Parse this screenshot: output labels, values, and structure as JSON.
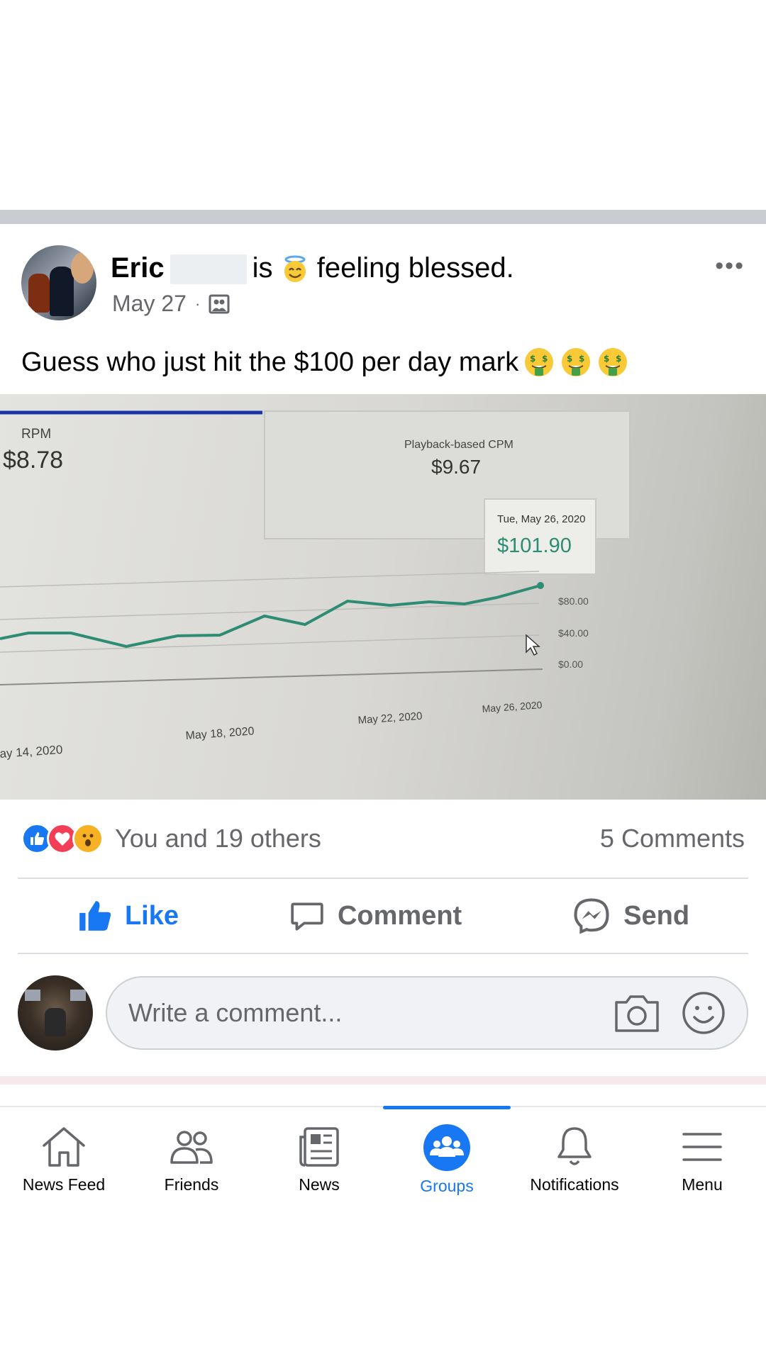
{
  "post": {
    "author": "Eric",
    "verb": "is",
    "feeling": "feeling blessed.",
    "date": "May 27",
    "dot": "·",
    "more": "•••",
    "text": "Guess who just hit the $100 per day mark"
  },
  "photo": {
    "rpm_label": "RPM",
    "rpm_value": "$8.78",
    "cpm_label": "Playback-based CPM",
    "cpm_value": "$9.67",
    "tooltip_date": "Tue, May 26, 2020",
    "tooltip_value": "$101.90",
    "y_ticks": [
      "$80.00",
      "$40.00",
      "$0.00"
    ],
    "x_ticks": [
      "ay 14, 2020",
      "May 18, 2020",
      "May 22, 2020",
      "May 26, 2020"
    ]
  },
  "reactions": {
    "summary": "You and 19 others",
    "comments": "5 Comments"
  },
  "actions": {
    "like": "Like",
    "comment": "Comment",
    "send": "Send"
  },
  "comment_box": {
    "placeholder": "Write a comment..."
  },
  "tabs": [
    {
      "label": "News Feed",
      "icon": "home-icon"
    },
    {
      "label": "Friends",
      "icon": "friends-icon"
    },
    {
      "label": "News",
      "icon": "news-icon"
    },
    {
      "label": "Groups",
      "icon": "groups-icon",
      "active": true
    },
    {
      "label": "Notifications",
      "icon": "bell-icon"
    },
    {
      "label": "Menu",
      "icon": "menu-icon"
    }
  ],
  "colors": {
    "accent": "#1877f2",
    "secondary_text": "#65676b",
    "chart_line": "#2e8b74"
  }
}
